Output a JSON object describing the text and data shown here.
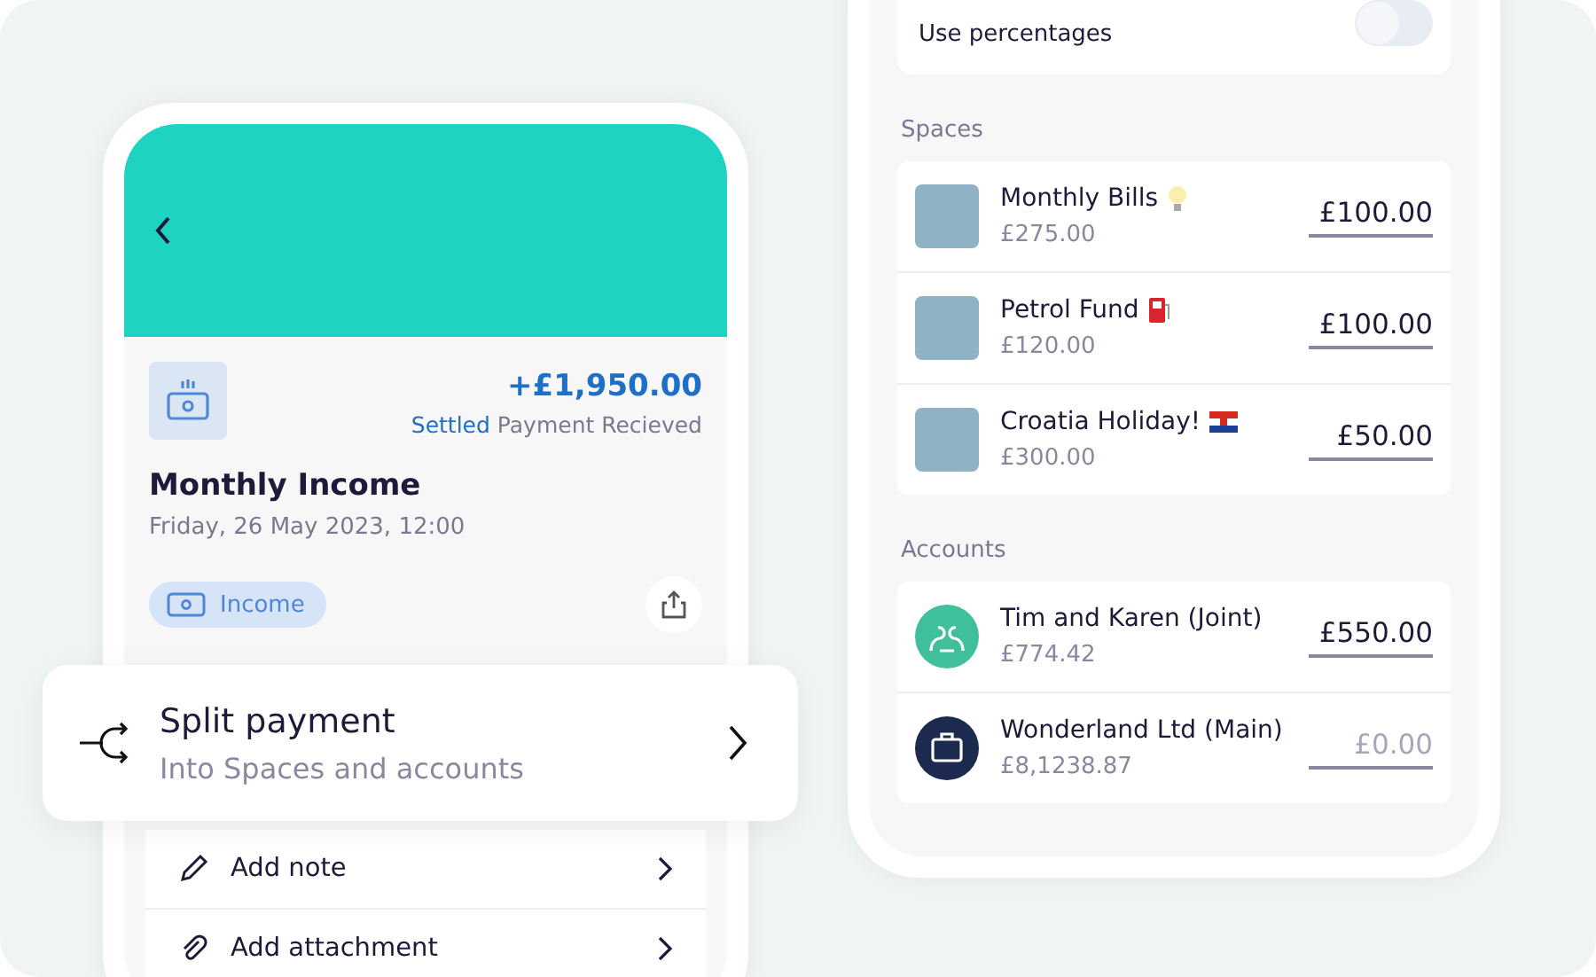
{
  "transaction": {
    "amount": "+£1,950.00",
    "status": "Settled",
    "status_text": "Payment Recieved",
    "title": "Monthly Income",
    "date": "Friday, 26 May 2023, 12:00",
    "category": "Income"
  },
  "split_payment": {
    "title": "Split payment",
    "subtitle": "Into Spaces and accounts"
  },
  "actions": [
    {
      "label": "Add note",
      "kind": "note"
    },
    {
      "label": "Add attachment",
      "kind": "attachment"
    }
  ],
  "percentages": {
    "label": "Use percentages",
    "on": false
  },
  "spaces": {
    "heading": "Spaces",
    "items": [
      {
        "name": "Monthly Bills",
        "balance": "£275.00",
        "amount": "£100.00",
        "kind": "bulb"
      },
      {
        "name": "Petrol Fund",
        "balance": "£120.00",
        "amount": "£100.00",
        "kind": "fuel"
      },
      {
        "name": "Croatia Holiday!",
        "balance": "£300.00",
        "amount": "£50.00",
        "kind": "flag"
      }
    ]
  },
  "accounts": {
    "heading": "Accounts",
    "items": [
      {
        "name": "Tim and Karen (Joint)",
        "balance": "£774.42",
        "amount": "£550.00",
        "kind": "joint"
      },
      {
        "name": "Wonderland Ltd (Main)",
        "balance": "£8,1238.87",
        "placeholder": "£0.00",
        "kind": "business"
      }
    ]
  }
}
